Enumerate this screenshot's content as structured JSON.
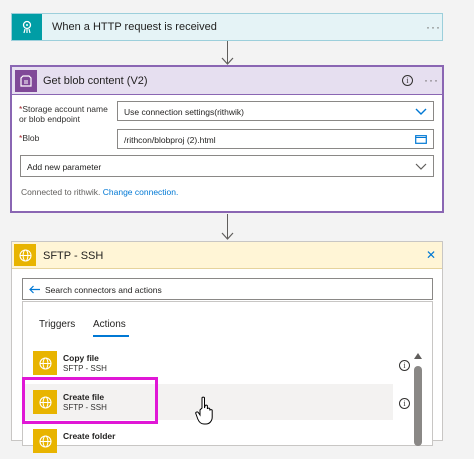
{
  "trigger": {
    "title": "When a HTTP request is received",
    "more": "···"
  },
  "blob": {
    "title": "Get blob content (V2)",
    "more": "···",
    "info": "i",
    "fields": [
      {
        "label_line1": "Storage account name",
        "label_line2": "or blob endpoint",
        "value": "Use connection settings(rithwik)",
        "required": "*"
      },
      {
        "label_line1": "Blob",
        "value": "/rithcon/blobproj (2).html",
        "required": "*"
      }
    ],
    "add_parameter": "Add new parameter",
    "connected_text": "Connected to rithwik.",
    "change_connection": "Change connection."
  },
  "sftp": {
    "title": "SFTP - SSH",
    "close": "✕",
    "search_placeholder": "Search connectors and actions",
    "tabs": [
      {
        "label": "Triggers"
      },
      {
        "label": "Actions"
      }
    ],
    "actions": [
      {
        "title": "Copy file",
        "subtitle": "SFTP - SSH"
      },
      {
        "title": "Create file",
        "subtitle": "SFTP - SSH"
      },
      {
        "title": "Create folder",
        "subtitle": ""
      }
    ]
  },
  "colors": {
    "accent": "#0078d4",
    "highlight": "#e017d6",
    "blob_brand": "#804998",
    "sftp_brand": "#e8b400",
    "trigger_brand": "#009da5"
  }
}
